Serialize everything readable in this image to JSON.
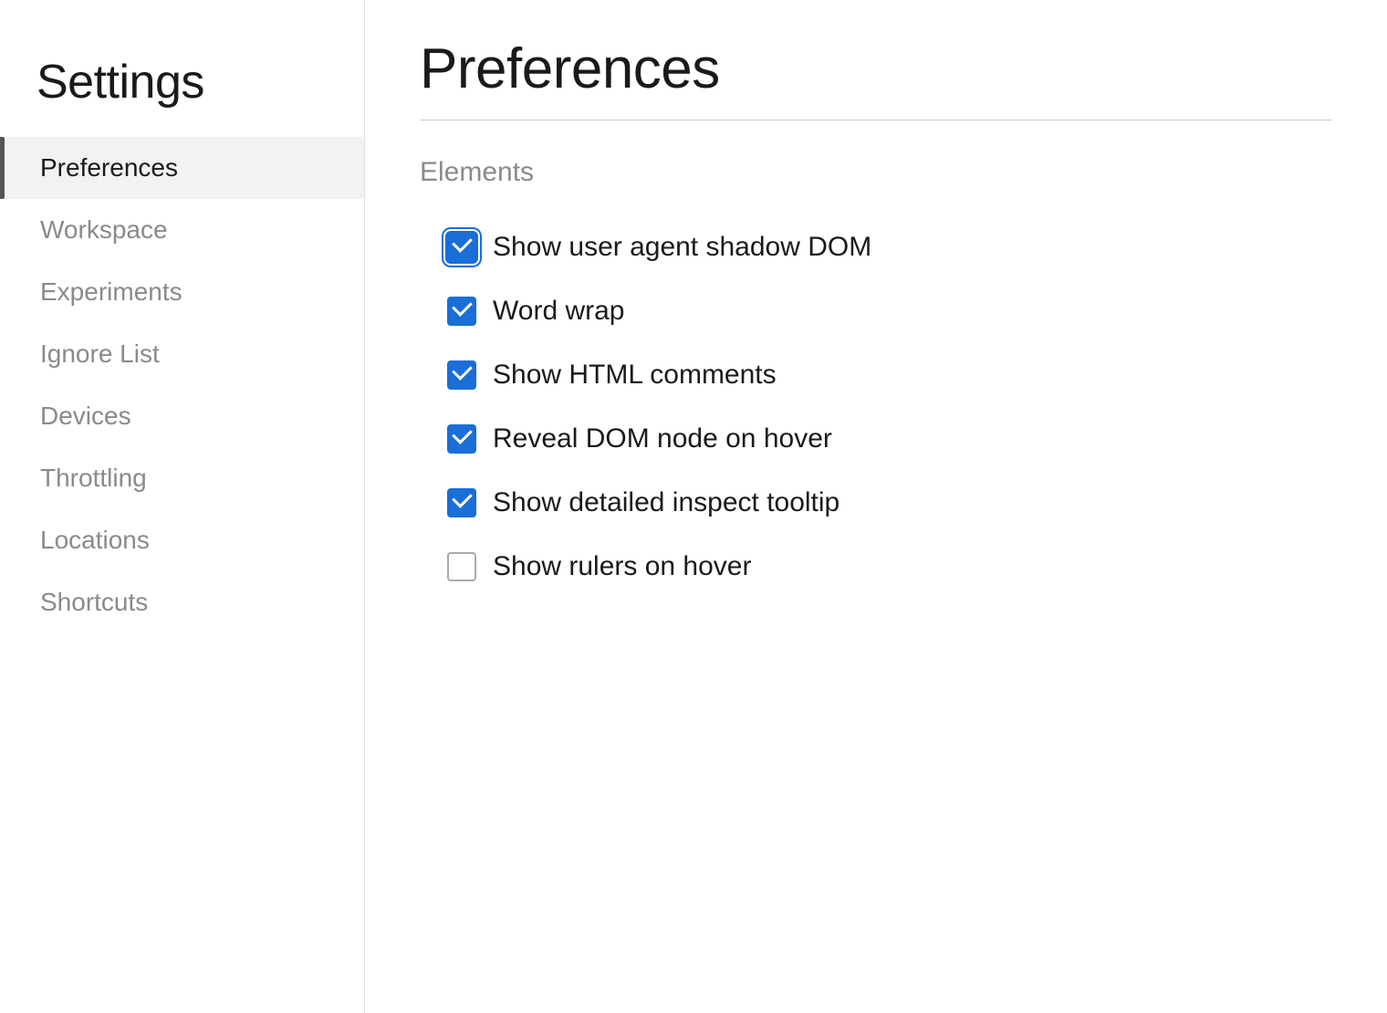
{
  "sidebar": {
    "title": "Settings",
    "nav_items": [
      {
        "id": "preferences",
        "label": "Preferences",
        "active": true
      },
      {
        "id": "workspace",
        "label": "Workspace",
        "active": false
      },
      {
        "id": "experiments",
        "label": "Experiments",
        "active": false
      },
      {
        "id": "ignore-list",
        "label": "Ignore List",
        "active": false
      },
      {
        "id": "devices",
        "label": "Devices",
        "active": false
      },
      {
        "id": "throttling",
        "label": "Throttling",
        "active": false
      },
      {
        "id": "locations",
        "label": "Locations",
        "active": false
      },
      {
        "id": "shortcuts",
        "label": "Shortcuts",
        "active": false
      }
    ]
  },
  "main": {
    "title": "Preferences",
    "sections": [
      {
        "id": "elements",
        "title": "Elements",
        "checkboxes": [
          {
            "id": "show-user-agent-shadow-dom",
            "label": "Show user agent shadow DOM",
            "checked": true,
            "outlined": true
          },
          {
            "id": "word-wrap",
            "label": "Word wrap",
            "checked": true,
            "outlined": false
          },
          {
            "id": "show-html-comments",
            "label": "Show HTML comments",
            "checked": true,
            "outlined": false
          },
          {
            "id": "reveal-dom-node-on-hover",
            "label": "Reveal DOM node on hover",
            "checked": true,
            "outlined": false
          },
          {
            "id": "show-detailed-inspect-tooltip",
            "label": "Show detailed inspect tooltip",
            "checked": true,
            "outlined": false
          },
          {
            "id": "show-rulers-on-hover",
            "label": "Show rulers on hover",
            "checked": false,
            "outlined": false
          }
        ]
      }
    ]
  }
}
